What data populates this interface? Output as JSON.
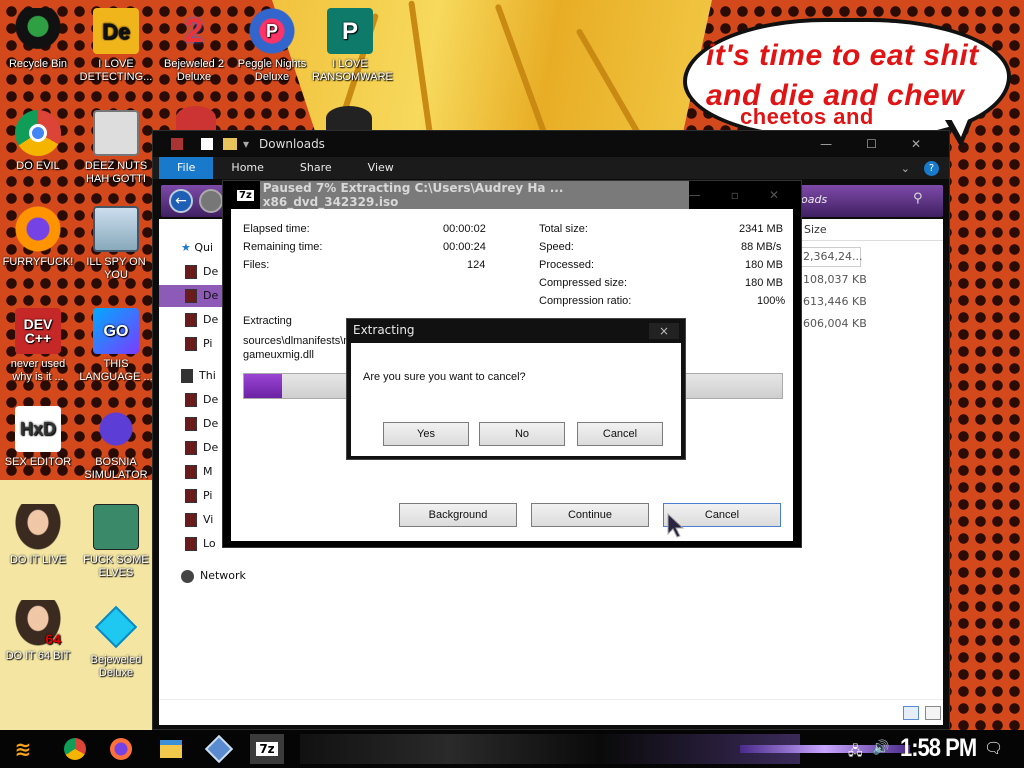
{
  "wallpaper": {
    "speech_line1": "it's time to eat shit",
    "speech_line2": "and die and chew",
    "speech_line3": "cheetos and"
  },
  "desktop_icons": [
    {
      "label": "Recycle Bin",
      "icon": "recycle-bin-icon"
    },
    {
      "label": "I LOVE DETECTING...",
      "icon": "detect-it-easy-icon"
    },
    {
      "label": "Bejeweled 2 Deluxe",
      "icon": "bejeweled-2-icon"
    },
    {
      "label": "Peggle Nights Deluxe",
      "icon": "peggle-nights-icon"
    },
    {
      "label": "I LOVE RANSOMWARE",
      "icon": "publisher-icon"
    },
    {
      "label": "DO EVIL",
      "icon": "chrome-icon"
    },
    {
      "label": "DEEZ NUTS HAH GOTTI",
      "icon": "windows-copy-icon"
    },
    {
      "label": "FURRYFUCK!",
      "icon": "firefox-icon"
    },
    {
      "label": "ILL SPY ON YOU",
      "icon": "remote-desktop-icon"
    },
    {
      "label": "never used why is it ...",
      "icon": "dev-cpp-icon"
    },
    {
      "label": "THIS LANGUAGE ...",
      "icon": "goland-icon"
    },
    {
      "label": "SEX EDITOR",
      "icon": "hxd-icon"
    },
    {
      "label": "BOSNIA SIMULATOR",
      "icon": "minesweeper-icon"
    },
    {
      "label": "DO IT LIVE",
      "icon": "portrait-icon"
    },
    {
      "label": "FUCK SOME ELVES",
      "icon": "santa-icon"
    },
    {
      "label": "DO IT 64 BIT",
      "icon": "portrait-64-icon"
    },
    {
      "label": "Bejeweled Deluxe",
      "icon": "bejeweled-icon"
    }
  ],
  "explorer": {
    "title": "Downloads",
    "tabs": [
      "File",
      "Home",
      "Share",
      "View"
    ],
    "search_placeholder": "oads",
    "size_header": "Size",
    "nav_quick_access": "Qui",
    "nav_items": [
      "De",
      "De",
      "De",
      "Pi"
    ],
    "nav_this_pc": "Thi",
    "nav_pc_items": [
      "De",
      "De",
      "De",
      "M",
      "Pi",
      "Vi",
      "Lo"
    ],
    "nav_network": "Network",
    "sizes": [
      "2,364,24...",
      "108,037 KB",
      "613,446 KB",
      "606,004 KB"
    ]
  },
  "zip": {
    "title": "Paused 7% Extracting C:\\Users\\Audrey Ha ... x86_dvd_342329.iso",
    "app_badge": "7z",
    "elapsed_label": "Elapsed time:",
    "elapsed_value": "00:00:02",
    "remaining_label": "Remaining time:",
    "remaining_value": "00:00:24",
    "files_label": "Files:",
    "files_value": "124",
    "total_label": "Total size:",
    "total_value": "2341 MB",
    "speed_label": "Speed:",
    "speed_value": "88 MB/s",
    "processed_label": "Processed:",
    "processed_value": "180 MB",
    "compressed_label": "Compressed size:",
    "compressed_value": "180 MB",
    "ratio_label": "Compression ratio:",
    "ratio_value": "100%",
    "extracting_label": "Extracting",
    "current_path": "sources\\dlmanifests\\m",
    "current_file": "gameuxmig.dll",
    "progress_percent": 7,
    "background_button": "Background",
    "continue_button": "Continue",
    "cancel_button": "Cancel"
  },
  "dialog": {
    "title": "Extracting",
    "close": "×",
    "message": "Are you sure you want to cancel?",
    "yes": "Yes",
    "no": "No",
    "cancel": "Cancel"
  },
  "taskbar": {
    "clock": "1:58 PM",
    "zip_badge": "7z"
  }
}
